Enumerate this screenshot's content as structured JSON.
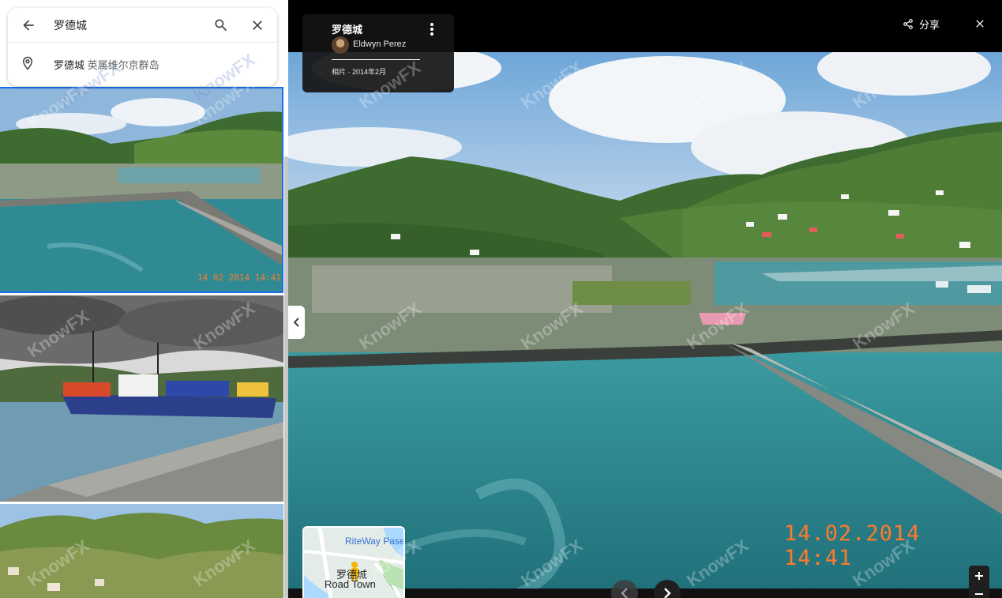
{
  "search": {
    "query": "罗德城"
  },
  "suggestion": {
    "title": "罗德城",
    "subtitle": "英属维尔京群岛"
  },
  "photos": [
    {
      "timestamp": "14 02 2014 14:41"
    },
    {},
    {}
  ],
  "viewer": {
    "place_title": "罗德城",
    "author": "Eldwyn Perez",
    "date": "相片 · 2014年2月",
    "share_label": "分享",
    "timestamp": "14.02.2014  14:41",
    "prev_enabled": false,
    "next_enabled": true
  },
  "minimap": {
    "road_label": "RiteWay Pase",
    "city_label": "罗德城",
    "city_label_en": "Road Town"
  },
  "watermark": "KnowFX",
  "icons": {
    "back": "arrow-left-icon",
    "search": "search-icon",
    "close": "close-icon",
    "pin": "location-pin-icon",
    "more": "more-vert-icon",
    "share": "share-icon",
    "collapse": "chevron-left-icon",
    "prev": "chevron-left-icon",
    "next": "chevron-right-icon",
    "zoom_in": "plus-icon",
    "zoom_out": "minus-icon",
    "pegman": "pegman-icon"
  },
  "colors": {
    "selection": "#1a73e8",
    "timestamp": "#ff7a2a",
    "sea": "#2f8a93",
    "hills": "#3e6b2f"
  }
}
